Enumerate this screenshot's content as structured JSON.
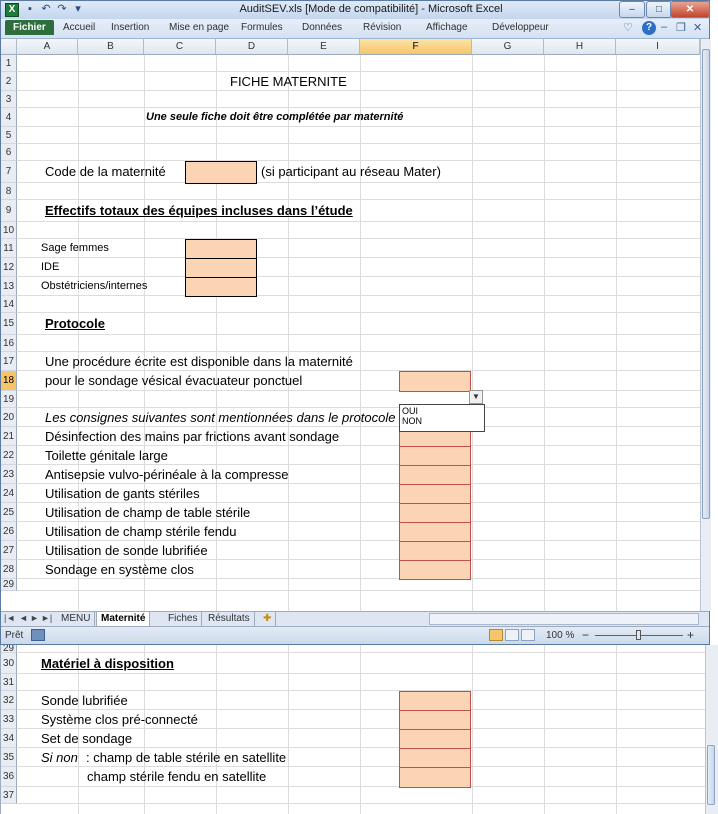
{
  "window": {
    "title": "AuditSEV.xls  [Mode de compatibilité] - Microsoft Excel",
    "app_icon_glyph": "X",
    "minimize_glyph": "–",
    "maximize_glyph": "□",
    "close_glyph": "✕"
  },
  "ribbon": {
    "tabs": [
      "Fichier",
      "Accueil",
      "Insertion",
      "Mise en page",
      "Formules",
      "Données",
      "Révision",
      "Affichage",
      "Développeur"
    ],
    "help_glyph": "?"
  },
  "columns": [
    "A",
    "B",
    "C",
    "D",
    "E",
    "F",
    "G",
    "H",
    "I"
  ],
  "selected_column": "F",
  "top_rows": [
    "1",
    "2",
    "3",
    "4",
    "5",
    "6",
    "7",
    "8",
    "9",
    "10",
    "11",
    "12",
    "13",
    "14",
    "15",
    "16",
    "17",
    "18",
    "19",
    "20",
    "21",
    "22",
    "23",
    "24",
    "25",
    "26",
    "27",
    "28",
    "29"
  ],
  "selected_row": "18",
  "cells": {
    "r2": "FICHE MATERNITE",
    "r4": "Une seule fiche doit être complétée par maternité",
    "r7a": "Code de la maternité",
    "r7b": "(si participant au réseau Mater)",
    "r9": "Effectifs totaux des équipes incluses dans l’étude",
    "r11": "Sage femmes",
    "r12": "IDE",
    "r13": "Obstétriciens/internes",
    "r15": "Protocole",
    "r17": "Une procédure écrite est disponible dans la maternité",
    "r18": "pour le sondage vésical évacuateur ponctuel",
    "r20": "Les consignes suivantes sont mentionnées dans le protocole :",
    "r21": "Désinfection des mains par frictions avant sondage",
    "r22": "Toilette génitale large",
    "r23": "Antisepsie vulvo-périnéale à la compresse",
    "r24": "Utilisation de gants stériles",
    "r25": "Utilisation de champ de table stérile",
    "r26": "Utilisation de champ stérile fendu",
    "r27": "Utilisation de sonde lubrifiée",
    "r28": "Sondage en système clos"
  },
  "dropdown": {
    "options": [
      "OUI",
      "NON"
    ],
    "arrow": "▼"
  },
  "sheet_tabs": {
    "nav": [
      "|◄",
      "◄",
      "►",
      "►|"
    ],
    "tabs": [
      "MENU",
      "Maternité",
      "Fiches",
      "Résultats"
    ],
    "active": "Maternité"
  },
  "status": {
    "ready": "Prêt",
    "zoom": "100 %",
    "zoom_minus": "−",
    "zoom_plus": "+"
  },
  "bottom_rows": [
    "29",
    "30",
    "31",
    "32",
    "33",
    "34",
    "35",
    "36",
    "37"
  ],
  "bottom_cells": {
    "r30": "Matériel à disposition",
    "r32": "Sonde lubrifiée",
    "r33": "Système clos pré-connecté",
    "r34": "Set de sondage",
    "r35_prefix": "Si non",
    "r35": " : champ de table stérile en satellite",
    "r36": "champ stérile fendu en satellite"
  },
  "colors": {
    "input_fill": "#fbd4b4",
    "excel_green": "#1e7b3a",
    "selection_header": "#f6c56a"
  }
}
